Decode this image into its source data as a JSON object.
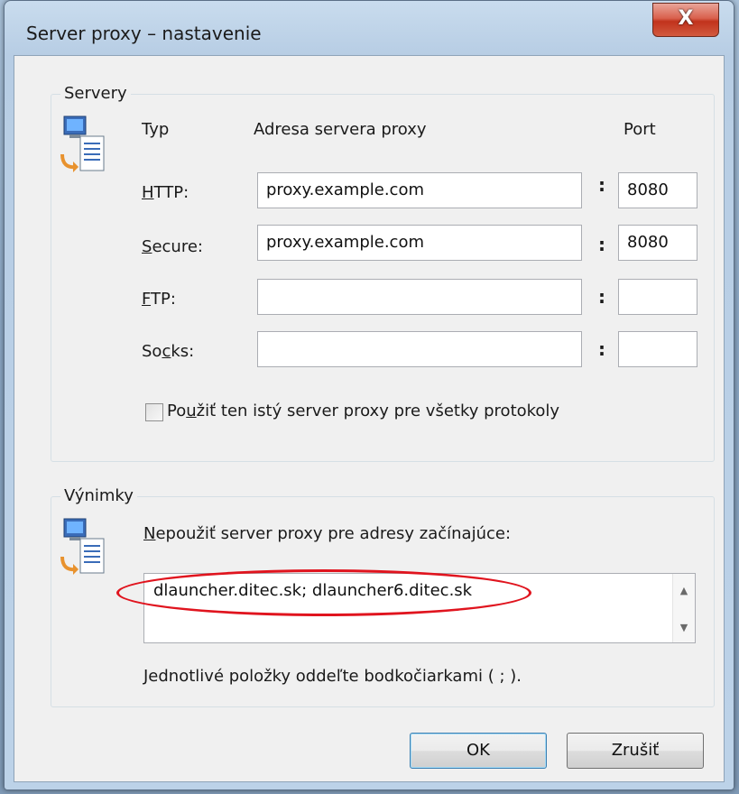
{
  "window": {
    "title": "Server proxy – nastavenie",
    "close_glyph": "X"
  },
  "servers": {
    "group_title": "Servery",
    "col_type": "Typ",
    "col_address": "Adresa servera proxy",
    "col_port": "Port",
    "rows": [
      {
        "label_pre": "",
        "label_key": "H",
        "label_post": "TTP:",
        "address": "proxy.example.com",
        "port": "8080"
      },
      {
        "label_pre": "",
        "label_key": "S",
        "label_post": "ecure:",
        "address": "proxy.example.com",
        "port": "8080"
      },
      {
        "label_pre": "",
        "label_key": "F",
        "label_post": "TP:",
        "address": "",
        "port": ""
      },
      {
        "label_pre": "So",
        "label_key": "c",
        "label_post": "ks:",
        "address": "",
        "port": ""
      }
    ],
    "colon": ":",
    "same_proxy_pre": "Po",
    "same_proxy_key": "u",
    "same_proxy_post": "žiť ten istý server proxy pre všetky protokoly",
    "same_proxy_checked": false
  },
  "exceptions": {
    "group_title": "Výnimky",
    "label_pre": "",
    "label_key": "N",
    "label_post": "epoužiť server proxy pre adresy začínajúce:",
    "value": "dlauncher.ditec.sk; dlauncher6.ditec.sk",
    "hint": "Jednotlivé položky oddeľte bodkočiarkami ( ; )."
  },
  "buttons": {
    "ok": "OK",
    "cancel": "Zrušiť"
  },
  "icons": {
    "server": "network-computer-icon"
  },
  "colors": {
    "highlight_ellipse": "#e0141e"
  }
}
